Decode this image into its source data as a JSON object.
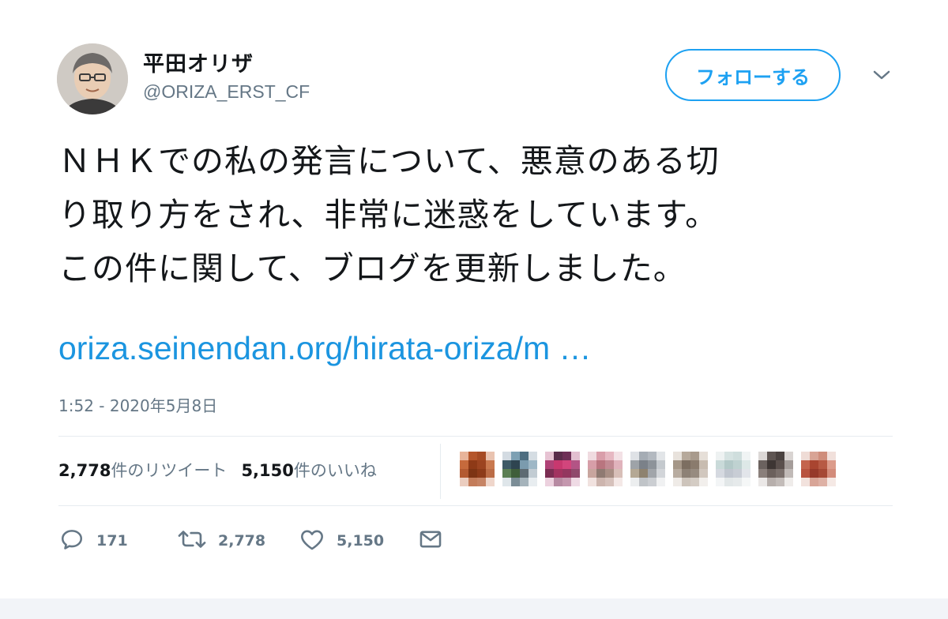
{
  "user": {
    "display_name": "平田オリザ",
    "handle": "@ORIZA_ERST_CF",
    "avatar_icon": "avatar-photo"
  },
  "follow_button": {
    "label": "フォローする"
  },
  "menu": {
    "icon": "chevron-down-icon"
  },
  "tweet": {
    "text": "ＮＨＫでの私の発言について、悪意のある切\nり取り方をされ、非常に迷惑をしています。\nこの件に関して、ブログを更新しました。",
    "link": "oriza.seinendan.org/hirata-oriza/m …",
    "timestamp": "1:52 - 2020年5月8日"
  },
  "stats": {
    "retweets_num": "2,778",
    "retweets_label": "件のリツイート",
    "likes_num": "5,150",
    "likes_label": "件のいいね"
  },
  "actions": {
    "reply_count": "171",
    "retweet_count": "2,778",
    "like_count": "5,150"
  },
  "colors": {
    "accent": "#1da1f2",
    "link": "#1b95e0",
    "muted": "#657786",
    "text": "#14171a"
  }
}
